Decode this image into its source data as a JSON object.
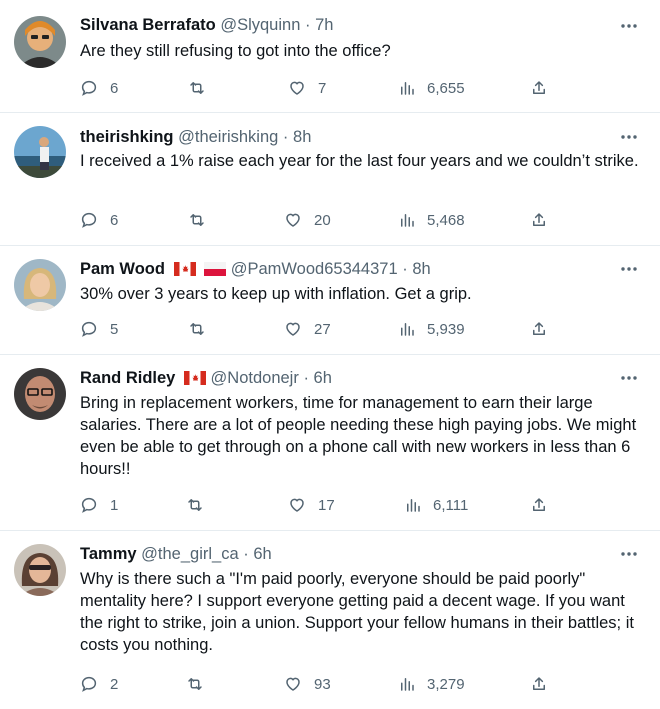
{
  "tweets": [
    {
      "name": "Silvana Berrafato",
      "handle": "@Slyquinn",
      "separator": "·",
      "time": "7h",
      "text": "Are they still refusing to got into the office?",
      "replies": "6",
      "likes": "7",
      "views": "6,655",
      "flags": [],
      "avatar": "avatar-silvana"
    },
    {
      "name": "theirishking",
      "handle": "@theirishking",
      "separator": "·",
      "time": "8h",
      "text": "I received a 1% raise each year for the last four years and we couldn’t strike.",
      "replies": "6",
      "likes": "20",
      "views": "5,468",
      "flags": [],
      "avatar": "avatar-theirishking"
    },
    {
      "name": "Pam Wood",
      "handle": "@PamWood65344371",
      "separator": "·",
      "time": "8h",
      "text": "30% over 3 years to keep up with inflation. Get a grip.",
      "replies": "5",
      "likes": "27",
      "views": "5,939",
      "flags": [
        "canada-flag",
        "poland-flag"
      ],
      "avatar": "avatar-pam"
    },
    {
      "name": "Rand Ridley",
      "handle": "@Notdonejr",
      "separator": "·",
      "time": "6h",
      "text": "Bring in replacement workers, time for management to earn their large salaries. There are a lot of people needing these high paying jobs. We might even be able to get through on a phone call with new workers in less than 6 hours!!",
      "replies": "1",
      "likes": "17",
      "views": "6,111",
      "flags": [
        "canada-flag"
      ],
      "avatar": "avatar-rand"
    },
    {
      "name": "Tammy",
      "handle": "@the_girl_ca",
      "separator": "·",
      "time": "6h",
      "text": "Why is there such a \"I'm paid poorly, everyone should be paid poorly\" mentality here? I support everyone getting paid a decent wage. If you want the right to strike, join a union. Support your fellow humans in their battles; it costs you nothing.",
      "replies": "2",
      "likes": "93",
      "views": "3,279",
      "flags": [],
      "avatar": "avatar-tammy"
    }
  ],
  "icons": {
    "reply": "reply-icon",
    "retweet": "retweet-icon",
    "like": "like-icon",
    "views": "views-icon",
    "share": "share-icon",
    "more": "more-icon"
  },
  "colors": {
    "text": "#0f1419",
    "secondary": "#536471",
    "divider": "#e6ecf0"
  }
}
